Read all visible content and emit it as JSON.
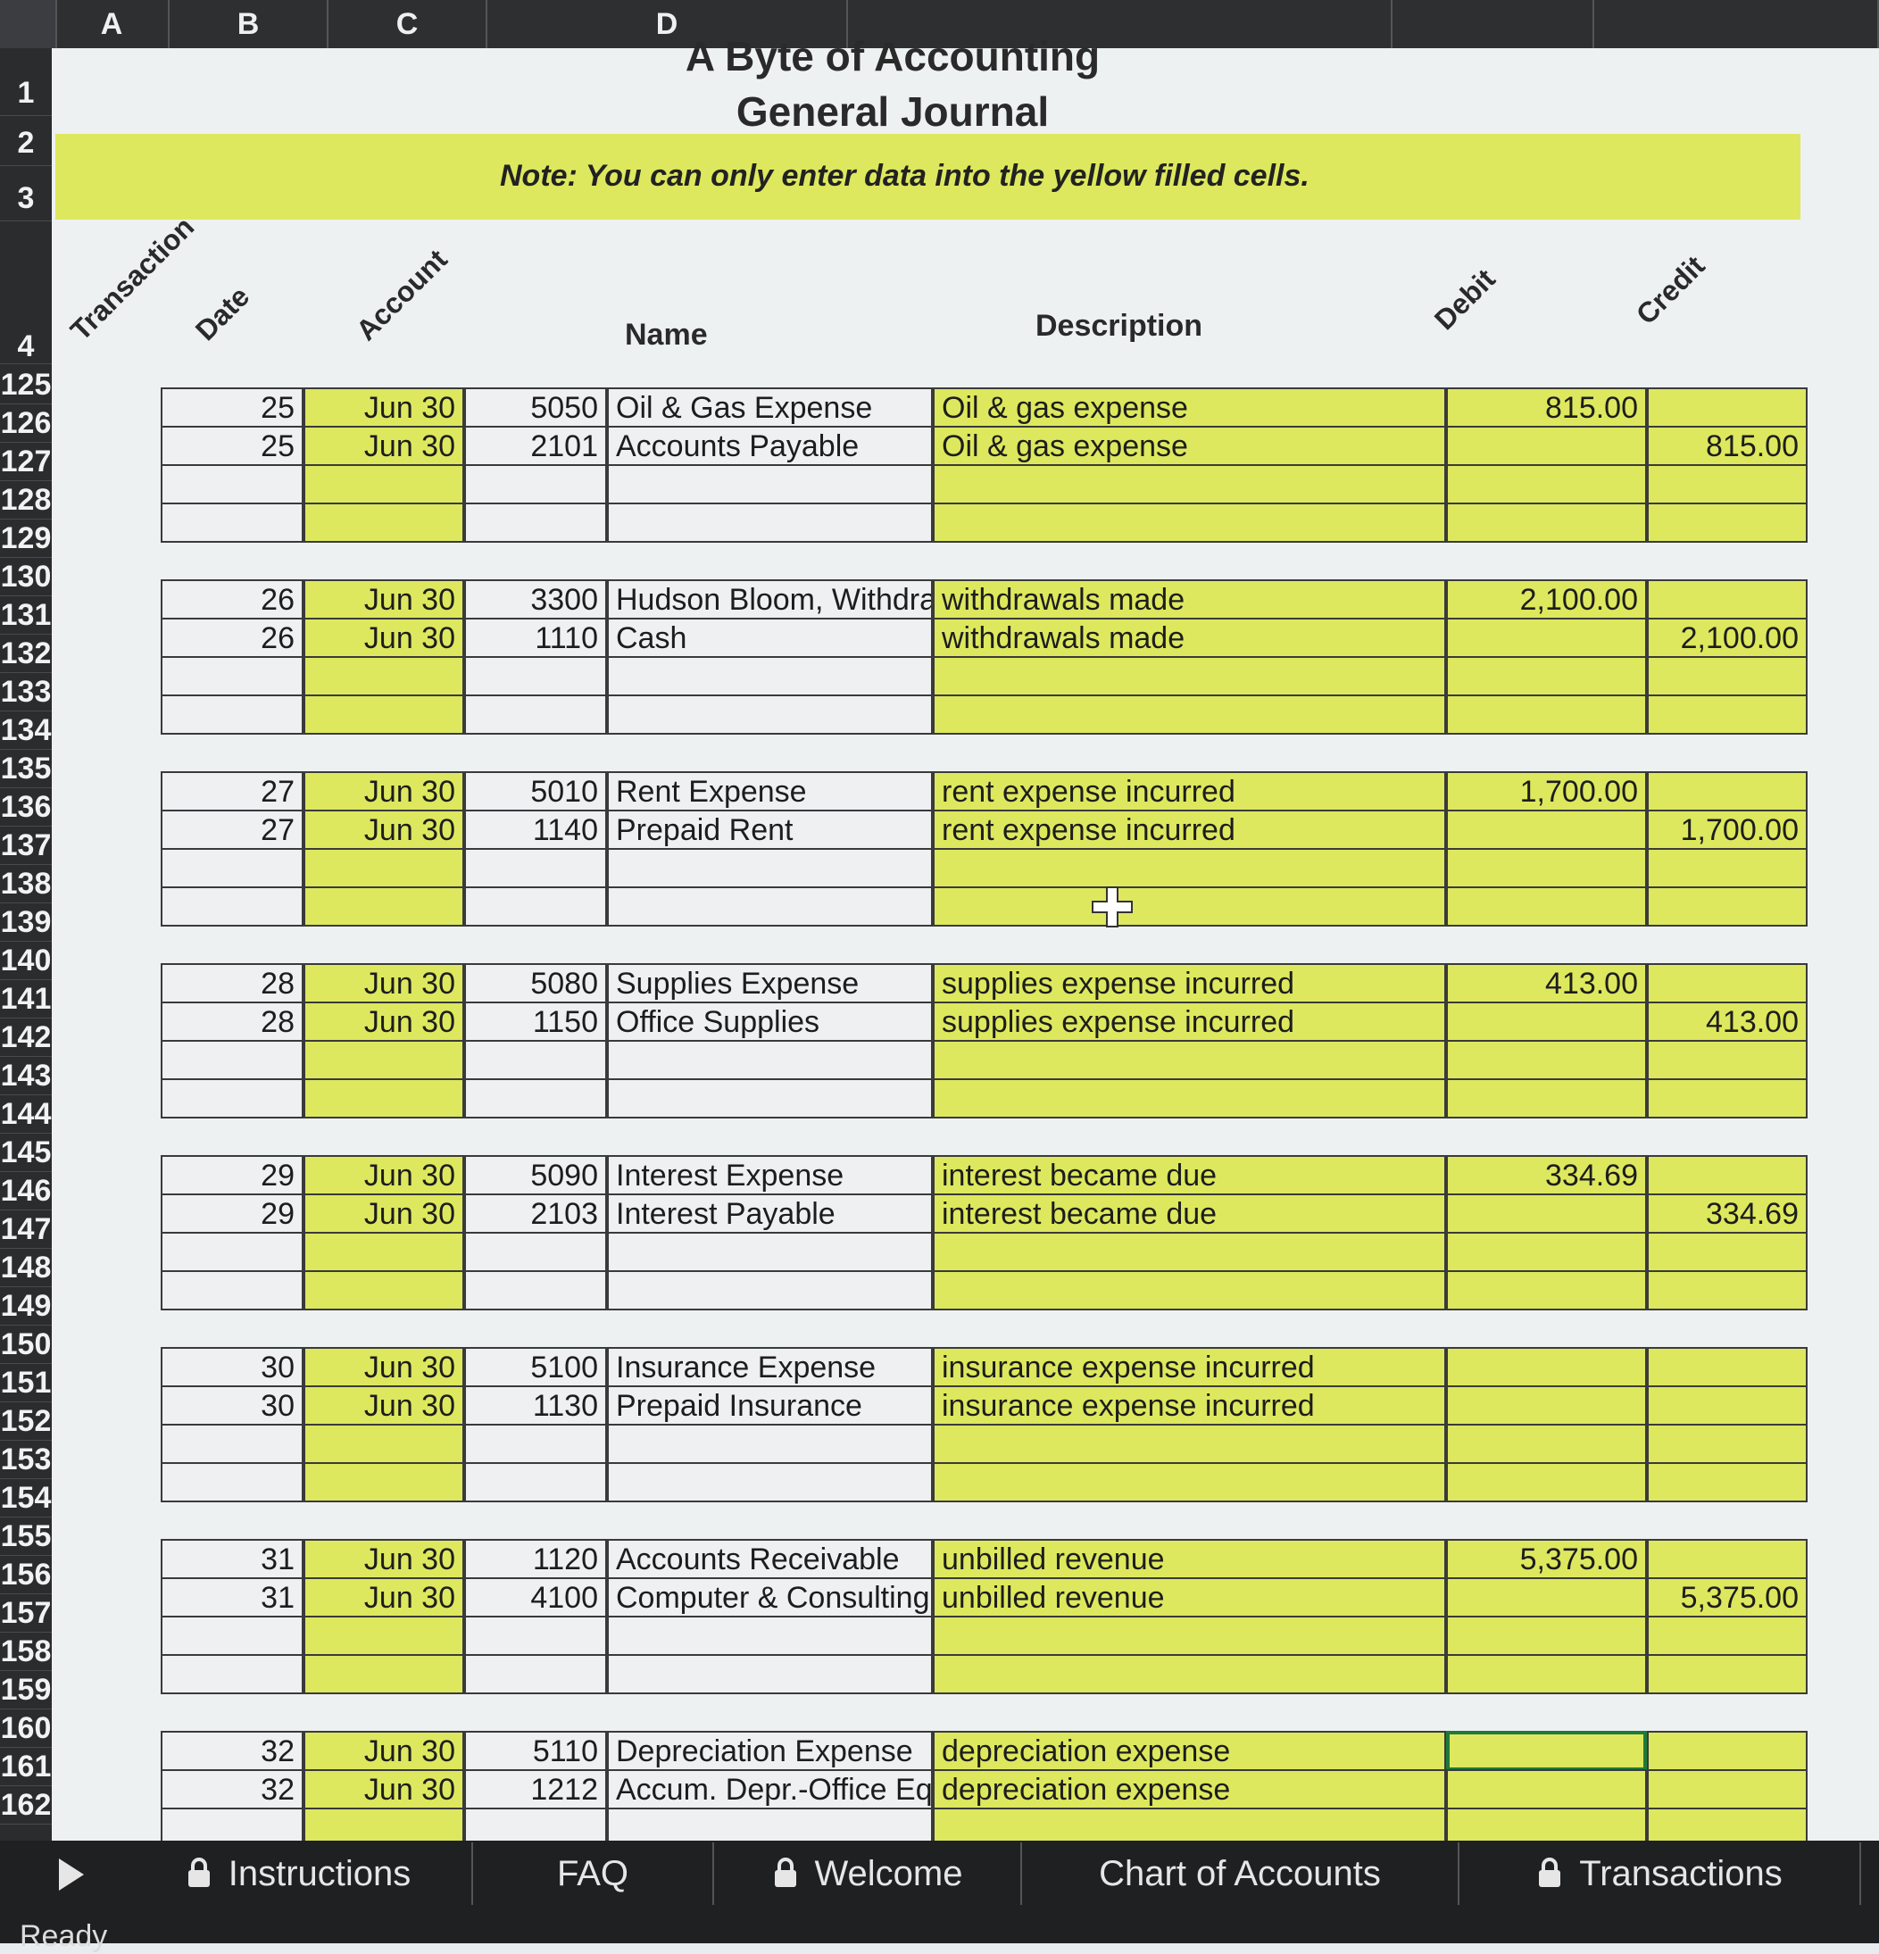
{
  "columns": [
    "A",
    "B",
    "C",
    "D"
  ],
  "row_numbers_top": [
    "1",
    "2",
    "3",
    "4"
  ],
  "row_numbers": [
    "125",
    "126",
    "127",
    "128",
    "129",
    "130",
    "131",
    "132",
    "133",
    "134",
    "135",
    "136",
    "137",
    "138",
    "139",
    "140",
    "141",
    "142",
    "143",
    "144",
    "145",
    "146",
    "147",
    "148",
    "149",
    "150",
    "151",
    "152",
    "153",
    "154",
    "155",
    "156",
    "157",
    "158",
    "159",
    "160",
    "161",
    "162"
  ],
  "title": {
    "line1": "A Byte of Accounting",
    "line2": "General Journal"
  },
  "note": "Note: You can only enter data into the yellow filled cells.",
  "headers": {
    "transaction": "Transaction",
    "date": "Date",
    "account": "Account",
    "name": "Name",
    "description": "Description",
    "debit": "Debit",
    "credit": "Credit"
  },
  "entries": [
    {
      "lines": [
        {
          "txn": "25",
          "date": "Jun 30",
          "acct": "5050",
          "name": "Oil & Gas Expense",
          "desc": "Oil & gas expense",
          "debit": "815.00",
          "credit": ""
        },
        {
          "txn": "25",
          "date": "Jun 30",
          "acct": "2101",
          "name": "Accounts Payable",
          "desc": "Oil & gas expense",
          "debit": "",
          "credit": "815.00"
        }
      ]
    },
    {
      "lines": [
        {
          "txn": "26",
          "date": "Jun 30",
          "acct": "3300",
          "name": "Hudson Bloom, Withdrawa",
          "desc": "withdrawals made",
          "debit": "2,100.00",
          "credit": ""
        },
        {
          "txn": "26",
          "date": "Jun 30",
          "acct": "1110",
          "name": "Cash",
          "desc": "withdrawals made",
          "debit": "",
          "credit": "2,100.00"
        }
      ]
    },
    {
      "lines": [
        {
          "txn": "27",
          "date": "Jun 30",
          "acct": "5010",
          "name": "Rent Expense",
          "desc": "rent expense incurred",
          "debit": "1,700.00",
          "credit": ""
        },
        {
          "txn": "27",
          "date": "Jun 30",
          "acct": "1140",
          "name": "Prepaid Rent",
          "desc": "rent expense incurred",
          "debit": "",
          "credit": "1,700.00"
        }
      ]
    },
    {
      "lines": [
        {
          "txn": "28",
          "date": "Jun 30",
          "acct": "5080",
          "name": "Supplies Expense",
          "desc": "supplies expense incurred",
          "debit": "413.00",
          "credit": ""
        },
        {
          "txn": "28",
          "date": "Jun 30",
          "acct": "1150",
          "name": "Office Supplies",
          "desc": "supplies expense incurred",
          "debit": "",
          "credit": "413.00"
        }
      ]
    },
    {
      "lines": [
        {
          "txn": "29",
          "date": "Jun 30",
          "acct": "5090",
          "name": "Interest Expense",
          "desc": "interest became due",
          "debit": "334.69",
          "credit": ""
        },
        {
          "txn": "29",
          "date": "Jun 30",
          "acct": "2103",
          "name": "Interest Payable",
          "desc": "interest became due",
          "debit": "",
          "credit": "334.69"
        }
      ]
    },
    {
      "lines": [
        {
          "txn": "30",
          "date": "Jun 30",
          "acct": "5100",
          "name": "Insurance Expense",
          "desc": "insurance expense incurred",
          "debit": "",
          "credit": ""
        },
        {
          "txn": "30",
          "date": "Jun 30",
          "acct": "1130",
          "name": "Prepaid Insurance",
          "desc": "insurance expense incurred",
          "debit": "",
          "credit": ""
        }
      ]
    },
    {
      "lines": [
        {
          "txn": "31",
          "date": "Jun 30",
          "acct": "1120",
          "name": "Accounts Receivable",
          "desc": "unbilled revenue",
          "debit": "5,375.00",
          "credit": ""
        },
        {
          "txn": "31",
          "date": "Jun 30",
          "acct": "4100",
          "name": "Computer & Consulting R",
          "desc": "unbilled revenue",
          "debit": "",
          "credit": "5,375.00"
        }
      ]
    },
    {
      "lines": [
        {
          "txn": "32",
          "date": "Jun 30",
          "acct": "5110",
          "name": "Depreciation Expense",
          "desc": "depreciation expense",
          "debit": "",
          "credit": ""
        },
        {
          "txn": "32",
          "date": "Jun 30",
          "acct": "1212",
          "name": "Accum. Depr.-Office Equip",
          "desc": "depreciation expense",
          "debit": "",
          "credit": ""
        }
      ]
    }
  ],
  "tabs": [
    {
      "label": "Instructions",
      "locked": true
    },
    {
      "label": "FAQ",
      "locked": false
    },
    {
      "label": "Welcome",
      "locked": true
    },
    {
      "label": "Chart of Accounts",
      "locked": false
    },
    {
      "label": "Transactions",
      "locked": true
    }
  ],
  "status": "Ready",
  "colors": {
    "yellow": "#dde85e",
    "header_bg": "#2e2f31",
    "selection": "#1f7a3a"
  },
  "icons": {
    "tab_lock": "lock-icon",
    "cursor": "cell-cursor-icon",
    "nav": "arrow-right-icon"
  }
}
